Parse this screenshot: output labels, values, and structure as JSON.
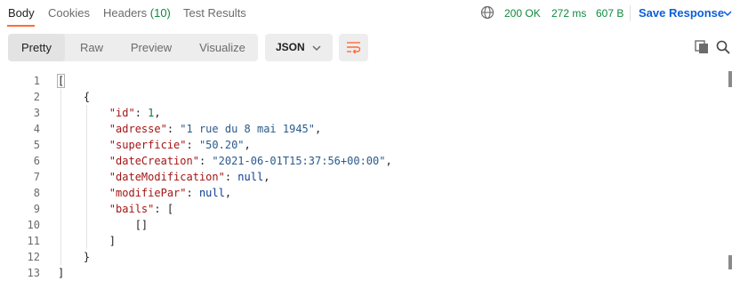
{
  "tabs": [
    {
      "label": "Body"
    },
    {
      "label": "Cookies"
    },
    {
      "label": "Headers",
      "count": "(10)"
    },
    {
      "label": "Test Results"
    }
  ],
  "status": {
    "code": "200 OK",
    "time": "272 ms",
    "size": "607 B",
    "save_label": "Save Response"
  },
  "view_modes": [
    "Pretty",
    "Raw",
    "Preview",
    "Visualize"
  ],
  "format_select": {
    "value": "JSON"
  },
  "icons": {
    "globe": "globe-icon",
    "wrap": "wrap-lines-icon",
    "copy": "copy-icon",
    "search": "search-icon"
  },
  "colors": {
    "accent": "#ff6c37",
    "success": "#0f8a3c",
    "link": "#0b5ed7"
  },
  "code": {
    "line_numbers": [
      "1",
      "2",
      "3",
      "4",
      "5",
      "6",
      "7",
      "8",
      "9",
      "10",
      "11",
      "12",
      "13"
    ],
    "lines": [
      {
        "indent": "",
        "parts": [
          {
            "t": "p",
            "v": "["
          }
        ]
      },
      {
        "indent": "    ",
        "parts": [
          {
            "t": "p",
            "v": "{"
          }
        ]
      },
      {
        "indent": "        ",
        "parts": [
          {
            "t": "k",
            "v": "\"id\""
          },
          {
            "t": "p",
            "v": ": "
          },
          {
            "t": "n",
            "v": "1"
          },
          {
            "t": "p",
            "v": ","
          }
        ]
      },
      {
        "indent": "        ",
        "parts": [
          {
            "t": "k",
            "v": "\"adresse\""
          },
          {
            "t": "p",
            "v": ": "
          },
          {
            "t": "s",
            "v": "\"1 rue du 8 mai 1945\""
          },
          {
            "t": "p",
            "v": ","
          }
        ]
      },
      {
        "indent": "        ",
        "parts": [
          {
            "t": "k",
            "v": "\"superficie\""
          },
          {
            "t": "p",
            "v": ": "
          },
          {
            "t": "s",
            "v": "\"50.20\""
          },
          {
            "t": "p",
            "v": ","
          }
        ]
      },
      {
        "indent": "        ",
        "parts": [
          {
            "t": "k",
            "v": "\"dateCreation\""
          },
          {
            "t": "p",
            "v": ": "
          },
          {
            "t": "s",
            "v": "\"2021-06-01T15:37:56+00:00\""
          },
          {
            "t": "p",
            "v": ","
          }
        ]
      },
      {
        "indent": "        ",
        "parts": [
          {
            "t": "k",
            "v": "\"dateModification\""
          },
          {
            "t": "p",
            "v": ": "
          },
          {
            "t": "u",
            "v": "null"
          },
          {
            "t": "p",
            "v": ","
          }
        ]
      },
      {
        "indent": "        ",
        "parts": [
          {
            "t": "k",
            "v": "\"modifiePar\""
          },
          {
            "t": "p",
            "v": ": "
          },
          {
            "t": "u",
            "v": "null"
          },
          {
            "t": "p",
            "v": ","
          }
        ]
      },
      {
        "indent": "        ",
        "parts": [
          {
            "t": "k",
            "v": "\"bails\""
          },
          {
            "t": "p",
            "v": ": ["
          }
        ]
      },
      {
        "indent": "            ",
        "parts": [
          {
            "t": "p",
            "v": "[]"
          }
        ]
      },
      {
        "indent": "        ",
        "parts": [
          {
            "t": "p",
            "v": "]"
          }
        ]
      },
      {
        "indent": "    ",
        "parts": [
          {
            "t": "p",
            "v": "}"
          }
        ]
      },
      {
        "indent": "",
        "parts": [
          {
            "t": "p",
            "v": "]"
          }
        ]
      }
    ]
  }
}
